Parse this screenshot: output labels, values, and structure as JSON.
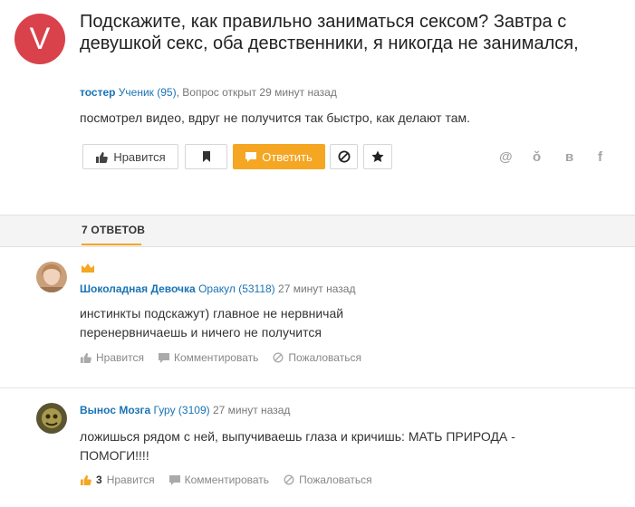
{
  "question": {
    "avatar_letter": "V",
    "title": "Подскажите, как правильно заниматься сексом? Завтра с девушкой секс, оба девственники, я никогда не занимался,",
    "author": "тостер",
    "author_rank": "Ученик (95),",
    "status": "Вопрос открыт 29 минут назад",
    "body": "посмотрел видео, вдруг не получится так быстро, как делают там."
  },
  "toolbar": {
    "like_label": "Нравится",
    "answer_label": "Ответить"
  },
  "share_icons": [
    "at-icon",
    "odnoklassniki-icon",
    "vk-icon",
    "facebook-icon"
  ],
  "share_glyphs": {
    "at": "@",
    "ok": "ǒ",
    "vk": "в",
    "fb": "f"
  },
  "tabs": {
    "answers_label": "7 ОТВЕТОВ"
  },
  "answers": [
    {
      "author": "Шоколадная Девочка",
      "rank": "Оракул (53118)",
      "time": "27 минут назад",
      "text": "инстинкты подскажут) главное не нервничай перенервничаешь и ничего не получится",
      "like_label": "Нравится",
      "comment_label": "Комментировать",
      "report_label": "Пожаловаться",
      "best_badge": "crown-icon"
    },
    {
      "author": "Вынос Мозга",
      "rank": "Гуру (3109)",
      "time": "27 минут назад",
      "text": "ложишься рядом с ней, выпучиваешь глаза и кричишь: МАТЬ ПРИРОДА - ПОМОГИ!!!!",
      "likes": "3",
      "like_label": "Нравится",
      "comment_label": "Комментировать",
      "report_label": "Пожаловаться"
    }
  ],
  "colors": {
    "accent": "#f5a623",
    "link": "#1a73b5",
    "avatar_bg": "#d9424b"
  }
}
